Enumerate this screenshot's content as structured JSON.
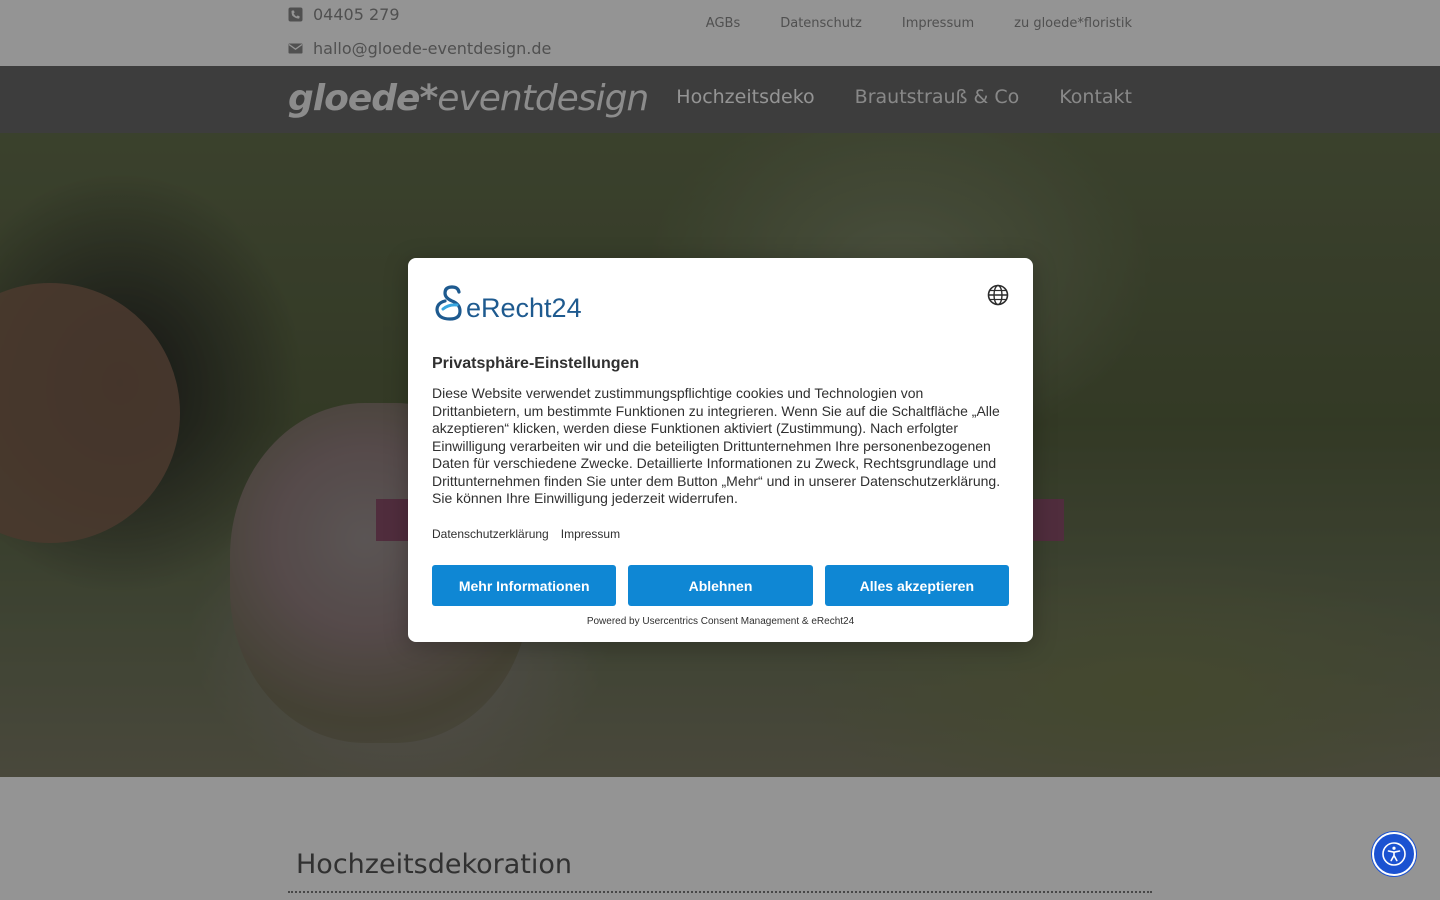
{
  "topbar": {
    "phone": "04405 279",
    "email": "hallo@gloede-eventdesign.de",
    "meta_links": [
      "AGBs",
      "Datenschutz",
      "Impressum",
      "zu gloede*floristik"
    ]
  },
  "header": {
    "logo_bold": "gloede*",
    "logo_light": "eventdesign",
    "nav": [
      "Hochzeitsdeko",
      "Brautstrauß & Co",
      "Kontakt"
    ]
  },
  "content": {
    "section_title": "Hochzeitsdekoration"
  },
  "consent": {
    "brand": "eRecht24",
    "title": "Privatsphäre-Einstellungen",
    "text": "Diese Website verwendet zustimmungspflichtige cookies und Technologien von Drittanbietern, um bestimmte Funktionen zu integrieren. Wenn Sie auf die Schaltfläche „Alle akzeptieren“ klicken, werden diese Funktionen aktiviert (Zustimmung). Nach erfolgter Einwilligung verarbeiten wir und die beteiligten Drittunternehmen Ihre personenbezogenen Daten für verschiedene Zwecke. Detaillierte Informationen zu Zweck, Rechtsgrundlage und Drittunternehmen finden Sie unter dem Button „Mehr“ und in unserer Datenschutzerklärung. Sie können Ihre Einwilligung jederzeit widerrufen.",
    "links": [
      "Datenschutzerklärung",
      "Impressum"
    ],
    "buttons": {
      "more": "Mehr Informationen",
      "deny": "Ablehnen",
      "accept": "Alles akzeptieren"
    },
    "powered_by": "Powered by Usercentrics Consent Management & eRecht24"
  },
  "colors": {
    "consent_button": "#0f87d4",
    "brand_blue": "#1e5a8f",
    "nav_bar": "#6a6a6a",
    "accessibility_button": "#1b52d1"
  },
  "icons": {
    "phone": "phone-icon",
    "email": "envelope-icon",
    "language": "globe-icon",
    "accessibility": "accessibility-icon"
  }
}
